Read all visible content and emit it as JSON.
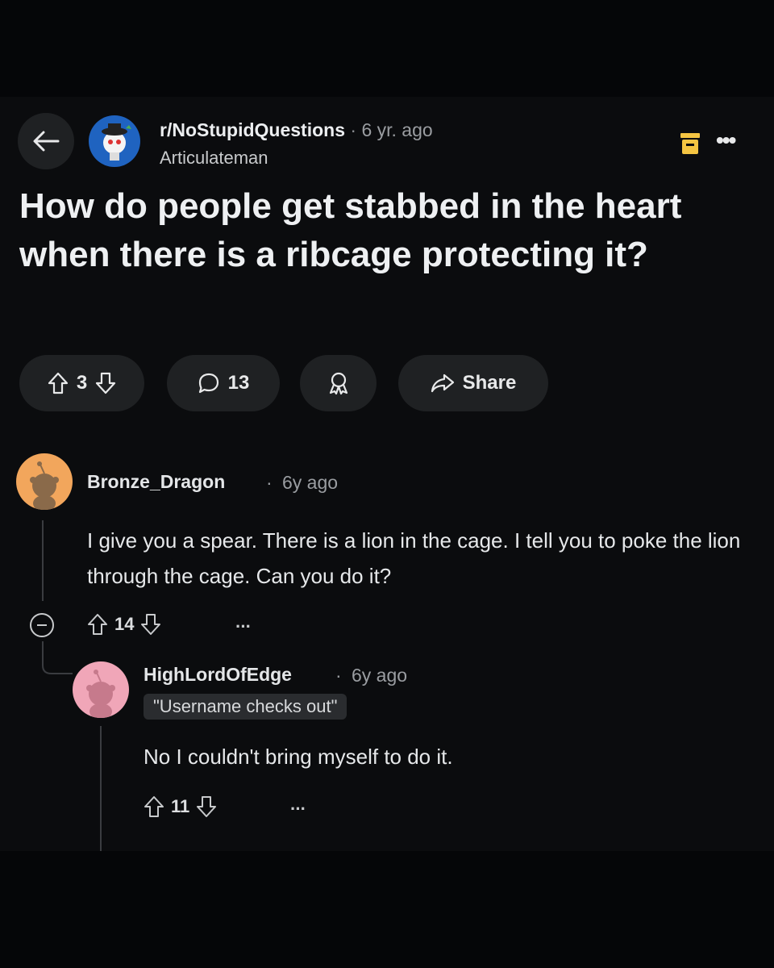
{
  "post": {
    "subreddit": "r/NoStupidQuestions",
    "separator": "·",
    "age": "6 yr. ago",
    "author": "Articulateman",
    "title": "How do people get stabbed in the heart when there is a ribcage protecting it?",
    "score": "3",
    "comment_count": "13",
    "share_label": "Share"
  },
  "comments": [
    {
      "author": "Bronze_Dragon",
      "separator": "·",
      "age": "6y ago",
      "body": "I give you a spear. There is a lion in the cage. I tell you to poke the lion through the cage. Can you do it?",
      "score": "14",
      "more": "···"
    },
    {
      "author": "HighLordOfEdge",
      "separator": "·",
      "age": "6y ago",
      "flair": "\"Username checks out\"",
      "body": "No I couldn't bring myself to do it.",
      "score": "11",
      "more": "···"
    }
  ],
  "icons": {
    "back": "arrow-left-icon",
    "mod": "mod-shield-icon",
    "more": "more-icon",
    "upvote": "arrow-up-outline-icon",
    "downvote": "arrow-down-outline-icon",
    "comment": "speech-bubble-icon",
    "award": "award-ribbon-icon",
    "share": "share-arrow-icon",
    "collapse": "collapse-minus-icon"
  },
  "colors": {
    "background": "#0b0c0e",
    "pill": "#1f2123",
    "subreddit_avatar": "#1f63c0",
    "mod_icon": "#f5c542",
    "avatar_1": "#f2a65c",
    "avatar_2": "#f0a6b8"
  }
}
